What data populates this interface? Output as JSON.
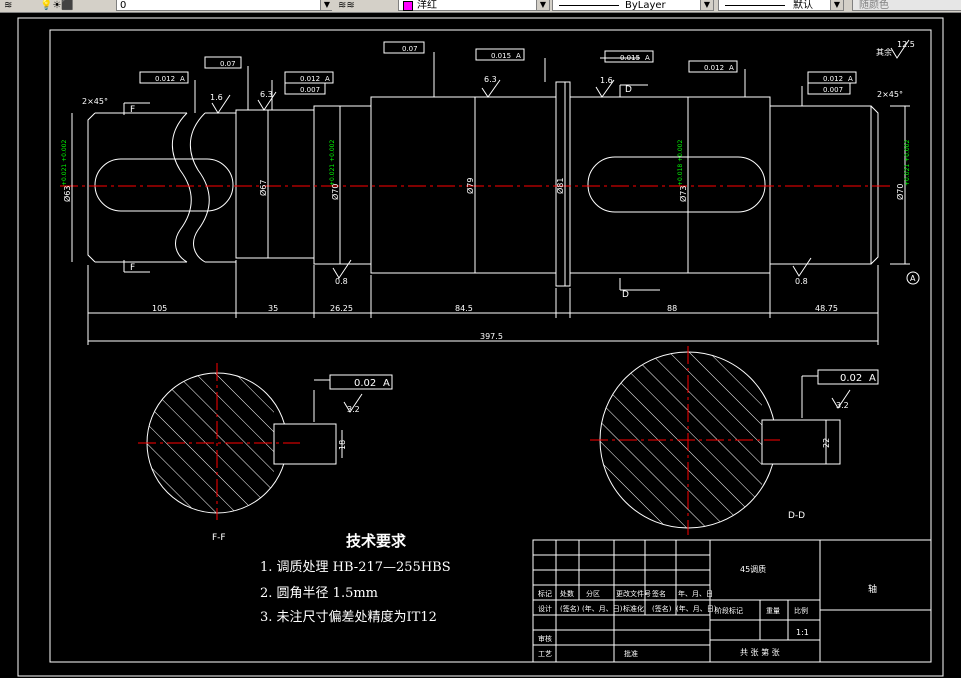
{
  "toolbar": {
    "layer_value": "0",
    "color_value": "洋红",
    "linetype_value": "ByLayer",
    "lineweight_value": "默认",
    "plotstyle_value": "随颜色"
  },
  "drawing": {
    "colors": {
      "background": "#000000",
      "line": "#ffffff",
      "center": "#ff0000",
      "tolerance": "#00ff00"
    },
    "dimensions": {
      "d105": "105",
      "d35": "35",
      "d26": "26.25",
      "d84": "84.5",
      "d88": "88",
      "d48": "48.75",
      "d397": "397.5",
      "dia63": "Ø63",
      "dia67": "Ø67",
      "dia70a": "Ø70",
      "dia79": "Ø79",
      "dia81": "Ø81",
      "dia73": "Ø73",
      "dia70b": "Ø70",
      "key18": "18",
      "key22": "22"
    },
    "tolerances": {
      "t_left": "+0.021\n+0.002",
      "t_seat": "+0.021\n+0.002",
      "t_key": "+0.018\n+0.002",
      "t_right": "+0.021\n+0.002"
    },
    "chamfer_left": "2×45°",
    "chamfer_right": "2×45°",
    "roughness": {
      "r1": "1.6",
      "r2": "6.3",
      "r3": "6.3",
      "r4": "1.6",
      "r5": "0.8",
      "r6": "0.8",
      "r7": "3.2",
      "r8": "3.2",
      "rest": "12.5",
      "rest_label": "其余"
    },
    "gdt": {
      "g1": "0.012",
      "g1r": "A",
      "g2": "0.07",
      "g3": "0.012",
      "g3r": "A",
      "g4": "0.007",
      "g5": "0.07",
      "g6": "0.015",
      "g6r": "A",
      "g7": "0.015",
      "g7r": "A",
      "g8": "0.012",
      "g8r": "A",
      "g9": "0.012",
      "g9r": "A",
      "g10": "0.007",
      "g11": "0.02",
      "g11r": "A",
      "g12": "0.02",
      "g12r": "A"
    },
    "section_labels": {
      "f_top": "F",
      "f_bot": "F",
      "d_top": "D",
      "d_bot": "D",
      "ff": "F-F",
      "dd": "D-D",
      "datum": "A"
    }
  },
  "tech": {
    "title": "技术要求",
    "items": [
      "1. 调质处理 HB-217—255HBS",
      "2. 圆角半径  1.5mm",
      "3. 未注尺寸偏差处精度为IT12"
    ]
  },
  "titleblock": {
    "material": "45调质",
    "part_name": "轴",
    "scale": "1:1",
    "row_labels": [
      "标记",
      "处数",
      "分区",
      "更改文件号",
      "签名",
      "年、月、日"
    ],
    "design_row": [
      "设计",
      "(签名)",
      "(年、月、日)",
      "标准化",
      "(签名)",
      "(年、月、日)"
    ],
    "left_labels": [
      "审核",
      "工艺"
    ],
    "approve": "批准",
    "stage_label": "阶段标记",
    "weight_label": "重量",
    "scale_label": "比例",
    "sheet_info": "共 张 第 张"
  }
}
